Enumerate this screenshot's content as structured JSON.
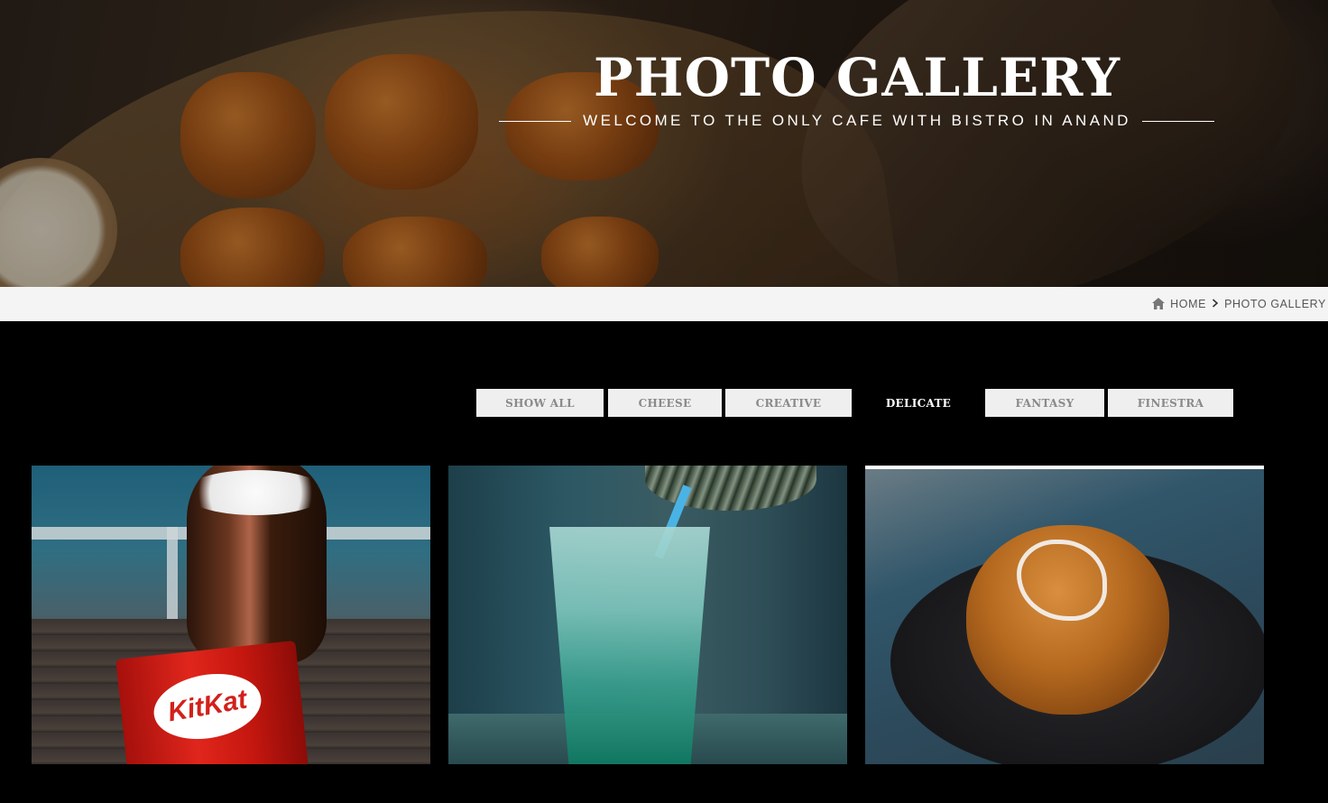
{
  "hero": {
    "title": "PHOTO GALLERY",
    "subtitle": "WELCOME TO THE ONLY CAFE WITH BISTRO IN ANAND"
  },
  "breadcrumb": {
    "home_icon": "home-icon",
    "home": "HOME",
    "separator_icon": "chevron-right-icon",
    "current": "PHOTO GALLERY"
  },
  "filters": {
    "items": [
      "SHOW ALL",
      "CHEESE",
      "CREATIVE",
      "DELICATE",
      "FANTASY",
      "FINESTRA"
    ],
    "active": "DELICATE"
  },
  "gallery": {
    "items": [
      {
        "subject": "KitKat"
      },
      {
        "subject": "blue drink"
      },
      {
        "subject": "grilled bun"
      }
    ],
    "kitkat_label": "KitKat"
  },
  "colors": {
    "page_background": "#000000",
    "breadcrumb_background": "#f4f4f4",
    "filter_background": "#efefef",
    "filter_text": "#8a8a8a",
    "filter_active_text": "#ffffff"
  }
}
